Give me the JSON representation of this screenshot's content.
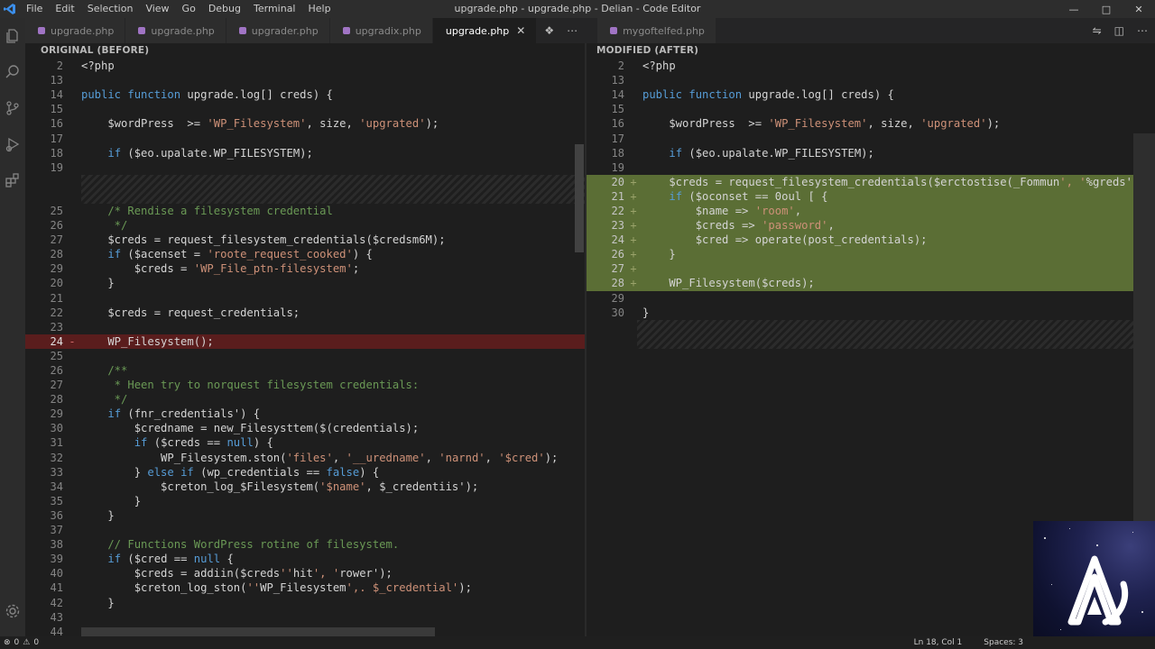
{
  "window": {
    "title": "upgrade.php - upgrade.php - Delian - Code Editor",
    "menu": [
      "File",
      "Edit",
      "Selection",
      "View",
      "Go",
      "Debug",
      "Terminal",
      "Help"
    ]
  },
  "tabs": [
    {
      "label": "upgrade.php",
      "active": false
    },
    {
      "label": "upgrade.php",
      "active": false
    },
    {
      "label": "upgrader.php",
      "active": false
    },
    {
      "label": "upgradix.php",
      "active": false
    },
    {
      "label": "upgrade.php",
      "active": true
    },
    {
      "label": "mygoftelfed.php",
      "active": false
    }
  ],
  "panes": {
    "left_header": "ORIGINAL (BEFORE)",
    "right_header": "MODIFIED (AFTER)"
  },
  "left_lines": [
    {
      "n": "2",
      "t": "<?php"
    },
    {
      "n": "13",
      "t": ""
    },
    {
      "n": "14",
      "t": "public function upgrade.log[] creds) {"
    },
    {
      "n": "15",
      "t": ""
    },
    {
      "n": "16",
      "t": "    $wordPress  >= 'WP_Filesystem', size, 'upgrated');"
    },
    {
      "n": "17",
      "t": ""
    },
    {
      "n": "18",
      "t": "    if ($eo.upalate.WP_FILESYSTEM);"
    },
    {
      "n": "19",
      "t": ""
    },
    {
      "hatch": true
    },
    {
      "n": "25",
      "t": "    /* Rendise a filesystem credential"
    },
    {
      "n": "26",
      "t": "     */"
    },
    {
      "n": "27",
      "t": "    $creds = request_filesystem_credentials($credsm6M);"
    },
    {
      "n": "28",
      "t": "    if ($acenset = 'roote_request_cooked') {"
    },
    {
      "n": "29",
      "t": "        $creds = 'WP_File_ptn-filesystem';"
    },
    {
      "n": "20",
      "t": "    }"
    },
    {
      "n": "21",
      "t": ""
    },
    {
      "n": "22",
      "t": "    $creds = request_credentials;"
    },
    {
      "n": "23",
      "t": ""
    },
    {
      "n": "24",
      "t": "    WP_Filesystem();",
      "mark": "-",
      "del": true
    },
    {
      "n": "25",
      "t": ""
    },
    {
      "n": "26",
      "t": "    /**"
    },
    {
      "n": "27",
      "t": "     * Heen try to norquest filesystem credentials:"
    },
    {
      "n": "28",
      "t": "     */"
    },
    {
      "n": "29",
      "t": "    if (fnr_credentials') {"
    },
    {
      "n": "30",
      "t": "        $credname = new_Filesysttem($(credentials);"
    },
    {
      "n": "31",
      "t": "        if ($creds == null) {"
    },
    {
      "n": "32",
      "t": "            WP_Filesystem.ston('files', '__uredname', 'narnd', '$cred');"
    },
    {
      "n": "33",
      "t": "        } else if (wp_credentials == false) {"
    },
    {
      "n": "34",
      "t": "            $creton_log_$Filesystem('$name', $_credentiis');"
    },
    {
      "n": "35",
      "t": "        }"
    },
    {
      "n": "36",
      "t": "    }"
    },
    {
      "n": "37",
      "t": ""
    },
    {
      "n": "38",
      "t": "    // Functions WordPress rotine of filesystem."
    },
    {
      "n": "39",
      "t": "    if ($cred == null {"
    },
    {
      "n": "40",
      "t": "        $creds = addiin($creds''hit', 'rower');"
    },
    {
      "n": "41",
      "t": "        $creton_log_ston(''WP_Filesystem',. $_credential');"
    },
    {
      "n": "42",
      "t": "    }"
    },
    {
      "n": "43",
      "t": ""
    },
    {
      "n": "44",
      "t": "    /**"
    }
  ],
  "right_lines": [
    {
      "n": "2",
      "t": "<?php"
    },
    {
      "n": "13",
      "t": ""
    },
    {
      "n": "14",
      "t": "public function upgrade.log[] creds) {"
    },
    {
      "n": "15",
      "t": ""
    },
    {
      "n": "16",
      "t": "    $wordPress  >= 'WP_Filesystem', size, 'upgrated');"
    },
    {
      "n": "17",
      "t": ""
    },
    {
      "n": "18",
      "t": "    if ($eo.upalate.WP_FILESYSTEM);"
    },
    {
      "n": "19",
      "t": ""
    },
    {
      "n": "20",
      "t": "    $creds = request_filesystem_credentials($erctostise(_Fommun', '%greds');",
      "mark": "+",
      "add": true
    },
    {
      "n": "21",
      "t": "    if ($oconset == 0oul [ {",
      "mark": "+",
      "add": true
    },
    {
      "n": "22",
      "t": "        $name => 'room',",
      "mark": "+",
      "add": true
    },
    {
      "n": "23",
      "t": "        $creds => 'password',",
      "mark": "+",
      "add": true
    },
    {
      "n": "24",
      "t": "        $cred => operate(post_credentials);",
      "mark": "+",
      "add": true
    },
    {
      "n": "26",
      "t": "    }",
      "mark": "+",
      "add": true
    },
    {
      "n": "27",
      "t": "",
      "mark": "+",
      "add": true
    },
    {
      "n": "28",
      "t": "    WP_Filesystem($creds);",
      "mark": "+",
      "add": true
    },
    {
      "n": "29",
      "t": ""
    },
    {
      "n": "30",
      "t": "}"
    },
    {
      "hatch": true
    }
  ],
  "status": {
    "errors": "0",
    "warnings": "0",
    "position": "Ln 18, Col 1",
    "spaces": "Spaces: 3"
  },
  "colors": {
    "deleted_line": "#5a1d1d",
    "added_line": "#5b6e35",
    "editor_bg": "#1e1e1e"
  }
}
